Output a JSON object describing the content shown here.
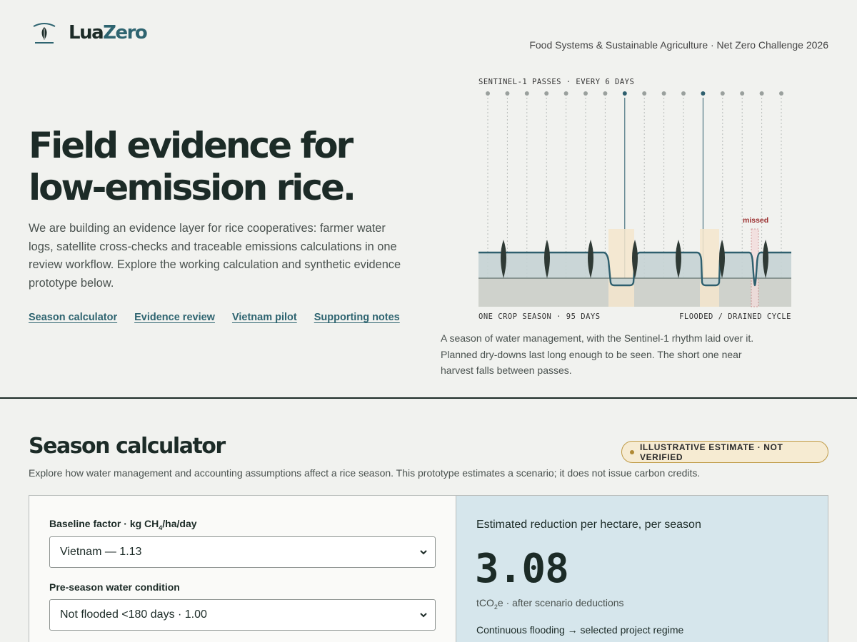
{
  "brand": {
    "name_part1": "Lua",
    "name_part2": "Zero",
    "tagline": "Food Systems & Sustainable Agriculture · Net Zero Challenge 2026"
  },
  "hero": {
    "title_line1": "Field evidence for",
    "title_line2": "low-emission rice.",
    "body": "We are building an evidence layer for rice cooperatives: farmer water logs, satellite cross-checks and traceable emissions calculations in one review workflow. Explore the working calculation and synthetic evidence prototype below.",
    "links": [
      "Season calculator",
      "Evidence review",
      "Vietnam pilot",
      "Supporting notes"
    ]
  },
  "viz": {
    "top_label": "SENTINEL-1 PASSES · EVERY 6 DAYS",
    "bottom_left": "ONE CROP SEASON · 95 DAYS",
    "bottom_right": "FLOODED / DRAINED CYCLE",
    "missed_label": "missed",
    "pass_count": 16,
    "highlight_pass_indices": [
      7,
      11
    ],
    "caption": "A season of water management, with the Sentinel-1 rhythm laid over it. Planned dry-downs last long enough to be seen. The short one near harvest falls between passes.",
    "colors": {
      "water": "#2e5f6e",
      "water_fill": "#c5d3d4",
      "soil": "#cfd2cc",
      "highlight": "#f5e6cc",
      "missed": "#9b3030",
      "plant": "#2f3a35"
    }
  },
  "calculator": {
    "title": "Season calculator",
    "subtitle": "Explore how water management and accounting assumptions affect a rice season. This prototype estimates a scenario; it does not issue carbon credits.",
    "badge": "ILLUSTRATIVE ESTIMATE · NOT VERIFIED",
    "baseline_label_prefix": "Baseline factor · kg CH",
    "baseline_label_sub": "4",
    "baseline_label_suffix": "/ha/day",
    "baseline_value": "Vietnam — 1.13",
    "preseason_label": "Pre-season water condition",
    "preseason_value": "Not flooded <180 days · 1.00",
    "result_label": "Estimated reduction per hectare, per season",
    "result_value": "3.08",
    "result_unit_prefix": "tCO",
    "result_unit_sub": "2",
    "result_unit_suffix": "e · after scenario deductions",
    "regime": "Continuous flooding → selected project regime"
  }
}
